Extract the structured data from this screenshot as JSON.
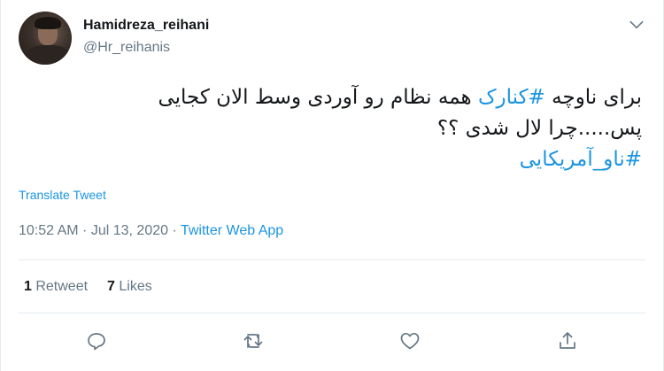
{
  "user": {
    "display_name": "Hamidreza_reihani",
    "handle": "@Hr_reihanis"
  },
  "tweet": {
    "line1_part1": "برای ناوچه ",
    "line1_hashtag": "#کنارک",
    "line1_part2": " همه نظام رو آوردی وسط الان کجایی",
    "line2": "پس.....چرا لال شدی ؟؟",
    "line3_hashtag": "#ناو_آمریکایی"
  },
  "translate_label": "Translate Tweet",
  "meta": {
    "time": "10:52 AM",
    "separator1": " · ",
    "date": "Jul 13, 2020",
    "separator2": " · ",
    "source": "Twitter Web App"
  },
  "stats": {
    "retweet_count": "1",
    "retweet_label": " Retweet",
    "like_count": "7",
    "like_label": " Likes"
  },
  "colors": {
    "link": "#1b95e0",
    "secondary": "#657786",
    "border": "#e6ecf0"
  },
  "icons": [
    "caret-down-icon",
    "reply-icon",
    "retweet-icon",
    "like-icon",
    "share-icon"
  ]
}
